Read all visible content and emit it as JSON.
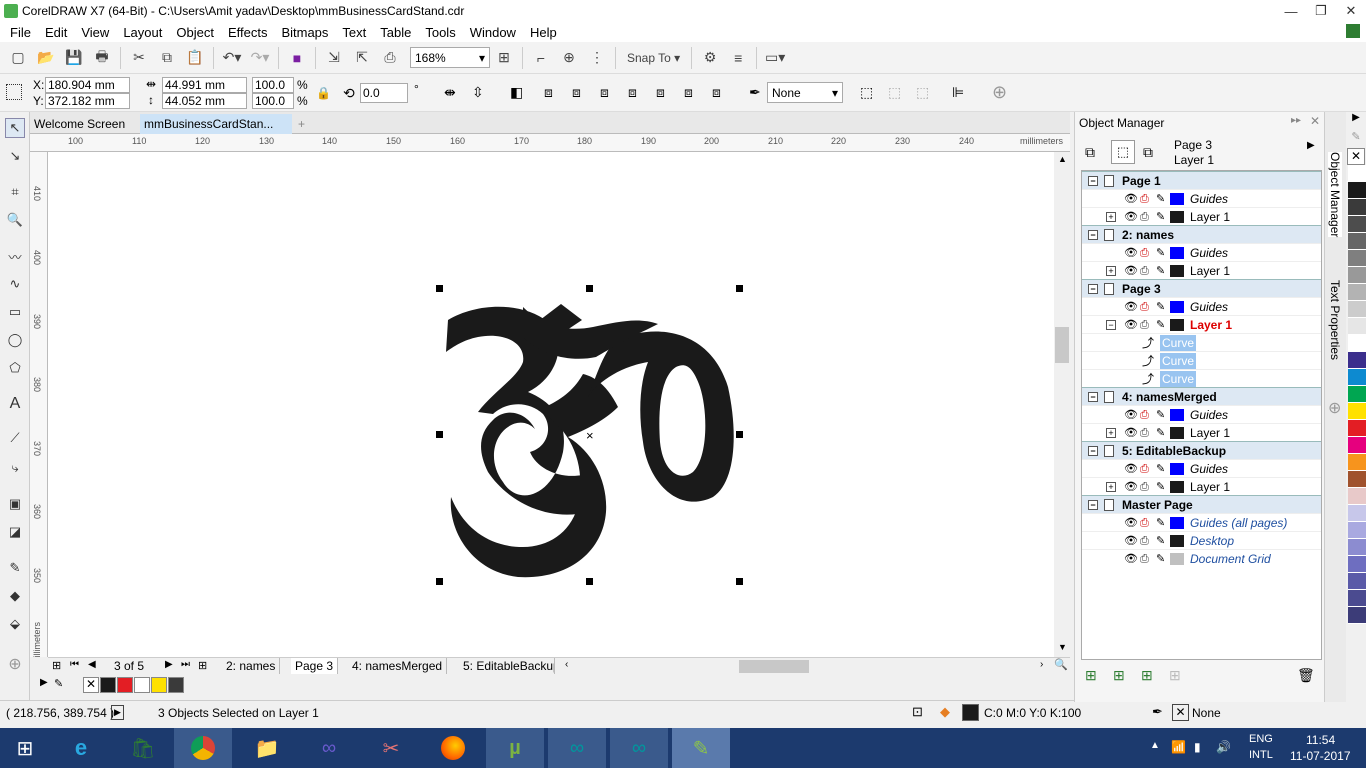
{
  "window": {
    "title": "CorelDRAW X7 (64-Bit) - C:\\Users\\Amit yadav\\Desktop\\mmBusinessCardStand.cdr",
    "min": "—",
    "max": "❐",
    "close": "✕"
  },
  "menu": [
    "File",
    "Edit",
    "View",
    "Layout",
    "Object",
    "Effects",
    "Bitmaps",
    "Text",
    "Table",
    "Tools",
    "Window",
    "Help"
  ],
  "toolbar": {
    "zoom": "168%",
    "snap_to": "Snap To"
  },
  "props": {
    "x": "180.904 mm",
    "y": "372.182 mm",
    "w": "44.991 mm",
    "h": "44.052 mm",
    "sx": "100.0",
    "sy": "100.0",
    "pct": "%",
    "angle": "0.0",
    "deg": "°",
    "outline": "None",
    "x_lbl": "X:",
    "y_lbl": "Y:"
  },
  "doc_tabs": [
    "Welcome Screen",
    "mmBusinessCardStan..."
  ],
  "ruler": {
    "h": [
      "100",
      "110",
      "120",
      "130",
      "140",
      "150",
      "160",
      "170",
      "180",
      "190",
      "200",
      "210",
      "220",
      "230",
      "240"
    ],
    "h_unit": "millimeters",
    "v": [
      "410",
      "400",
      "390",
      "380",
      "370",
      "360",
      "350"
    ],
    "v_unit": "millimeters"
  },
  "pages": {
    "counter": "3 of 5",
    "tabs": [
      "2: names",
      "Page 3",
      "4: namesMerged",
      "5: EditableBackup"
    ]
  },
  "object_manager": {
    "title": "Object Manager",
    "current_page": "Page 3",
    "current_layer": "Layer 1",
    "rows": [
      {
        "kind": "page",
        "label": "Page 1"
      },
      {
        "kind": "layer",
        "label": "Guides",
        "color": "#0000ff",
        "italic": true
      },
      {
        "kind": "layer",
        "label": "Layer 1",
        "color": "#1a1a1a",
        "plus": true
      },
      {
        "kind": "page",
        "label": "2: names"
      },
      {
        "kind": "layer",
        "label": "Guides",
        "color": "#0000ff",
        "italic": true
      },
      {
        "kind": "layer",
        "label": "Layer 1",
        "color": "#1a1a1a",
        "plus": true
      },
      {
        "kind": "page",
        "label": "Page 3"
      },
      {
        "kind": "layer",
        "label": "Guides",
        "color": "#0000ff",
        "italic": true
      },
      {
        "kind": "layer",
        "label": "Layer 1",
        "color": "#1a1a1a",
        "minus": true,
        "active": true
      },
      {
        "kind": "object",
        "label": "Curve"
      },
      {
        "kind": "object",
        "label": "Curve"
      },
      {
        "kind": "object",
        "label": "Curve"
      },
      {
        "kind": "page",
        "label": "4: namesMerged"
      },
      {
        "kind": "layer",
        "label": "Guides",
        "color": "#0000ff",
        "italic": true
      },
      {
        "kind": "layer",
        "label": "Layer 1",
        "color": "#1a1a1a",
        "plus": true
      },
      {
        "kind": "page",
        "label": "5: EditableBackup"
      },
      {
        "kind": "layer",
        "label": "Guides",
        "color": "#0000ff",
        "italic": true
      },
      {
        "kind": "layer",
        "label": "Layer 1",
        "color": "#1a1a1a",
        "plus": true
      },
      {
        "kind": "page",
        "label": "Master Page"
      },
      {
        "kind": "layer",
        "label": "Guides (all pages)",
        "color": "#0000ff",
        "italic": true,
        "blue": true
      },
      {
        "kind": "layer",
        "label": "Desktop",
        "color": "#1a1a1a",
        "italic": true,
        "blue": true
      },
      {
        "kind": "layer",
        "label": "Document Grid",
        "color": "#c0c0c0",
        "italic": true,
        "blue": true
      }
    ]
  },
  "side_tabs": [
    "Object Manager",
    "Text Properties"
  ],
  "status": {
    "coords": "( 218.756, 389.754 )",
    "message": "3 Objects Selected on Layer 1",
    "fill": "C:0 M:0 Y:0 K:100",
    "outline": "None"
  },
  "palette": [
    "#ffffff",
    "#1a1a1a",
    "#3a3a3a",
    "#4d4d4d",
    "#666666",
    "#7f7f7f",
    "#999999",
    "#b3b3b3",
    "#cccccc",
    "#e6e6e6",
    "#ffffff",
    "#3b2e8c",
    "#0d8ad0",
    "#00a651",
    "#ffe100",
    "#e31e24",
    "#e6007e",
    "#f7941d",
    "#a0522d",
    "#e8c9c9",
    "#c7c7ea",
    "#a9a9e0",
    "#8c8cd0",
    "#6e6ec0",
    "#5a5aa8",
    "#4b4b90",
    "#3c3c78"
  ],
  "doc_palette": [
    "#1a1a1a",
    "#e31e24",
    "#ffffff",
    "#ffe100",
    "#3a3a3a"
  ],
  "taskbar": {
    "lang1": "ENG",
    "lang2": "INTL",
    "time": "11:54",
    "date": "11-07-2017"
  }
}
